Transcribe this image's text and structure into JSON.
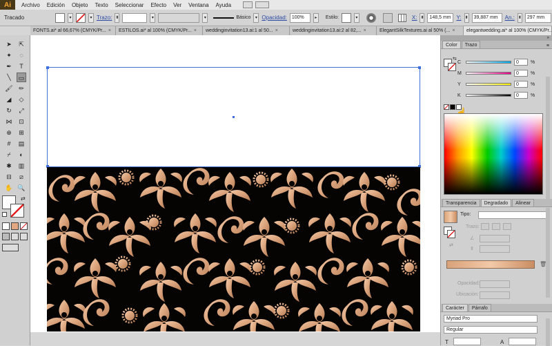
{
  "app": {
    "logo": "Ai"
  },
  "menu": [
    "Archivo",
    "Edición",
    "Objeto",
    "Texto",
    "Seleccionar",
    "Efecto",
    "Ver",
    "Ventana",
    "Ayuda"
  ],
  "control": {
    "object_label": "Tracado",
    "stroke_label": "Trazo:",
    "brush_label": "Básico",
    "opacity_label": "Opacidad:",
    "opacity_value": "100%",
    "style_label": "Estilo:",
    "x_label": "X:",
    "x_value": "148,5 mm",
    "y_label": "Y:",
    "y_value": "39,887 mm",
    "w_label": "An.:",
    "w_value": "297 mm"
  },
  "tabs": [
    {
      "label": "FONTS.ai* al 66,67% (CMYK/Pr...",
      "active": false
    },
    {
      "label": "ESTILOS.ai* al 100% (CMYK/Pr...",
      "active": false
    },
    {
      "label": "weddinginvitation13.ai:1 al 50...",
      "active": false
    },
    {
      "label": "weddinginvitation13.ai:2 al 82,...",
      "active": false
    },
    {
      "label": "ElegantSilkTextures.ai al 50% (...",
      "active": false
    },
    {
      "label": "elegantwedding.ai* al 100% (CMYK/Pr...",
      "active": true
    }
  ],
  "color_panel": {
    "tabs": [
      "Color",
      "Trazo"
    ],
    "channels": [
      {
        "label": "C",
        "value": "0",
        "unit": "%",
        "gradient": "linear-gradient(to right,#fff,#00aeef)"
      },
      {
        "label": "M",
        "value": "0",
        "unit": "%",
        "gradient": "linear-gradient(to right,#fff,#ec008c)"
      },
      {
        "label": "Y",
        "value": "0",
        "unit": "%",
        "gradient": "linear-gradient(to right,#fff,#fff200)"
      },
      {
        "label": "K",
        "value": "0",
        "unit": "%",
        "gradient": "linear-gradient(to right,#fff,#000)"
      }
    ]
  },
  "gradient_panel": {
    "tabs": [
      "Transparencia",
      "Degradado",
      "Alinear"
    ],
    "type_label": "Tipo:",
    "stroke_label": "Trazo:",
    "opacity_label": "Opacidad:",
    "location_label": "Ubicación:",
    "gradient_colors": [
      "#d9a27a",
      "#f3c9a8",
      "#c98d62"
    ]
  },
  "character_panel": {
    "tabs": [
      "Carácter",
      "Párrafo"
    ],
    "font_family": "Myriad Pro",
    "font_style": "Regular"
  },
  "colors": {
    "accent": "#3d6fdc",
    "pattern_bg": "#050402",
    "pattern_fill": "#e3a882"
  }
}
